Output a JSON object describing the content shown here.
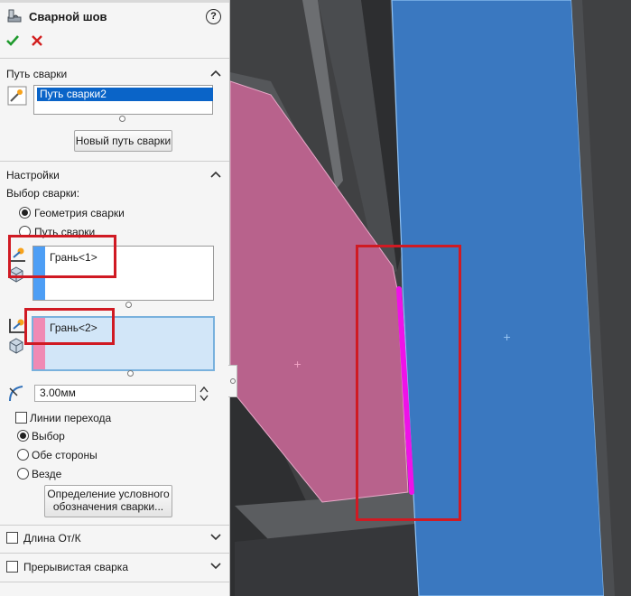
{
  "panel": {
    "title": "Сварной шов",
    "help_icon": "?",
    "confirm_icon": "checkmark-icon",
    "cancel_icon": "x-icon"
  },
  "weld_path": {
    "header": "Путь сварки",
    "items": [
      "Путь сварки2"
    ],
    "new_path_button": "Новый путь сварки"
  },
  "settings": {
    "header": "Настройки",
    "selection_label": "Выбор сварки:",
    "radios": [
      {
        "label": "Геометрия сварки",
        "selected": true
      },
      {
        "label": "Путь сварки",
        "selected": false
      }
    ],
    "face_set1": {
      "label": "Грань<1>",
      "color": "#4d9ef5"
    },
    "face_set2": {
      "label": "Грань<2>",
      "color": "#f08ab4"
    },
    "size_value": "3.00мм",
    "tangent_label": "Линии перехода",
    "tangent_checked": false,
    "side_options": [
      {
        "label": "Выбор",
        "selected": true
      },
      {
        "label": "Обе стороны",
        "selected": false
      },
      {
        "label": "Везде",
        "selected": false
      }
    ],
    "define_symbol_button_line1": "Определение условного",
    "define_symbol_button_line2": "обозначения сварки..."
  },
  "sections": {
    "length_label": "Длина От/К",
    "intermittent_label": "Прерывистая сварка"
  },
  "colors": {
    "face_blue": "#3a78c0",
    "face_pink": "#b8628c",
    "weld_bead": "#ee12e8",
    "highlight_box": "#d01a23",
    "accent_check": "#1f9a2d",
    "accent_cancel": "#d21e1e"
  }
}
